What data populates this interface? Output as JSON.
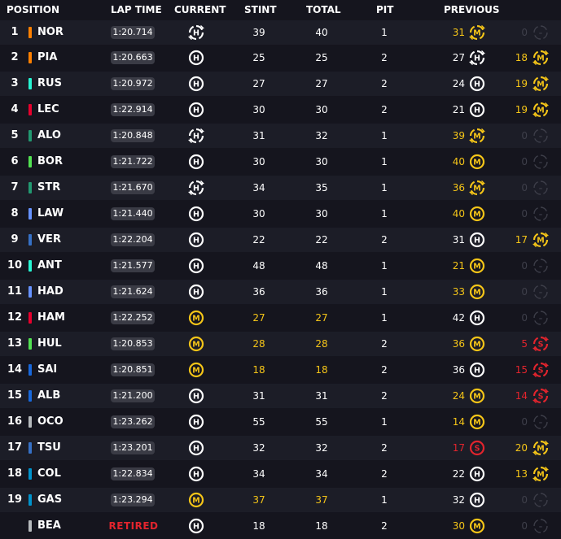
{
  "header": {
    "position": "POSITION",
    "lap_time": "LAP TIME",
    "current": "CURRENT",
    "stint": "STINT",
    "total": "TOTAL",
    "pit": "PIT",
    "previous": "PREVIOUS"
  },
  "tyre_letters": {
    "hard": "H",
    "medium": "M",
    "soft": "S",
    "none": "–"
  },
  "colors": {
    "hard": "#ffffff",
    "medium": "#f5c518",
    "soft": "#e2242d",
    "none": "#3e3f4a",
    "highlight": "#f5c518",
    "retired": "#e2242d",
    "mclaren": "#ff8000",
    "mercedes": "#27f4d2",
    "ferrari": "#e8002d",
    "aston": "#229971",
    "sauber": "#52e252",
    "rb": "#6692ff",
    "redbull": "#3671c6",
    "haas": "#b6babd",
    "williams": "#1868db",
    "alpine": "#0093cc"
  },
  "rows": [
    {
      "pos": "1",
      "abbr": "NOR",
      "team_color": "#ff8000",
      "lap": "1:20.714",
      "cur": "hard",
      "cur_new": false,
      "stint": "39",
      "total": "40",
      "pit": "1",
      "prev_n": "31",
      "prev": "medium",
      "prev_new": false,
      "old_n": "0",
      "old": "none"
    },
    {
      "pos": "2",
      "abbr": "PIA",
      "team_color": "#ff8000",
      "lap": "1:20.663",
      "cur": "hard",
      "cur_new": true,
      "stint": "25",
      "total": "25",
      "pit": "2",
      "prev_n": "27",
      "prev": "hard",
      "prev_new": false,
      "old_n": "18",
      "old": "medium"
    },
    {
      "pos": "3",
      "abbr": "RUS",
      "team_color": "#27f4d2",
      "lap": "1:20.972",
      "cur": "hard",
      "cur_new": true,
      "stint": "27",
      "total": "27",
      "pit": "2",
      "prev_n": "24",
      "prev": "hard",
      "prev_new": true,
      "old_n": "19",
      "old": "medium"
    },
    {
      "pos": "4",
      "abbr": "LEC",
      "team_color": "#e8002d",
      "lap": "1:22.914",
      "cur": "hard",
      "cur_new": true,
      "stint": "30",
      "total": "30",
      "pit": "2",
      "prev_n": "21",
      "prev": "hard",
      "prev_new": true,
      "old_n": "19",
      "old": "medium"
    },
    {
      "pos": "5",
      "abbr": "ALO",
      "team_color": "#229971",
      "lap": "1:20.848",
      "cur": "hard",
      "cur_new": false,
      "stint": "31",
      "total": "32",
      "pit": "1",
      "prev_n": "39",
      "prev": "medium",
      "prev_new": false,
      "old_n": "0",
      "old": "none"
    },
    {
      "pos": "6",
      "abbr": "BOR",
      "team_color": "#52e252",
      "lap": "1:21.722",
      "cur": "hard",
      "cur_new": true,
      "stint": "30",
      "total": "30",
      "pit": "1",
      "prev_n": "40",
      "prev": "medium",
      "prev_new": true,
      "old_n": "0",
      "old": "none"
    },
    {
      "pos": "7",
      "abbr": "STR",
      "team_color": "#229971",
      "lap": "1:21.670",
      "cur": "hard",
      "cur_new": false,
      "stint": "34",
      "total": "35",
      "pit": "1",
      "prev_n": "36",
      "prev": "medium",
      "prev_new": false,
      "old_n": "0",
      "old": "none"
    },
    {
      "pos": "8",
      "abbr": "LAW",
      "team_color": "#6692ff",
      "lap": "1:21.440",
      "cur": "hard",
      "cur_new": true,
      "stint": "30",
      "total": "30",
      "pit": "1",
      "prev_n": "40",
      "prev": "medium",
      "prev_new": true,
      "old_n": "0",
      "old": "none"
    },
    {
      "pos": "9",
      "abbr": "VER",
      "team_color": "#3671c6",
      "lap": "1:22.204",
      "cur": "hard",
      "cur_new": true,
      "stint": "22",
      "total": "22",
      "pit": "2",
      "prev_n": "31",
      "prev": "hard",
      "prev_new": true,
      "old_n": "17",
      "old": "medium"
    },
    {
      "pos": "10",
      "abbr": "ANT",
      "team_color": "#27f4d2",
      "lap": "1:21.577",
      "cur": "hard",
      "cur_new": true,
      "stint": "48",
      "total": "48",
      "pit": "1",
      "prev_n": "21",
      "prev": "medium",
      "prev_new": true,
      "old_n": "0",
      "old": "none"
    },
    {
      "pos": "11",
      "abbr": "HAD",
      "team_color": "#6692ff",
      "lap": "1:21.624",
      "cur": "hard",
      "cur_new": true,
      "stint": "36",
      "total": "36",
      "pit": "1",
      "prev_n": "33",
      "prev": "medium",
      "prev_new": true,
      "old_n": "0",
      "old": "none"
    },
    {
      "pos": "12",
      "abbr": "HAM",
      "team_color": "#e8002d",
      "lap": "1:22.252",
      "cur": "medium",
      "cur_new": true,
      "stint": "27",
      "total": "27",
      "pit": "1",
      "prev_n": "42",
      "prev": "hard",
      "prev_new": true,
      "old_n": "0",
      "old": "none"
    },
    {
      "pos": "13",
      "abbr": "HUL",
      "team_color": "#52e252",
      "lap": "1:20.853",
      "cur": "medium",
      "cur_new": true,
      "stint": "28",
      "total": "28",
      "pit": "2",
      "prev_n": "36",
      "prev": "medium",
      "prev_new": true,
      "old_n": "5",
      "old": "soft"
    },
    {
      "pos": "14",
      "abbr": "SAI",
      "team_color": "#1868db",
      "lap": "1:20.851",
      "cur": "medium",
      "cur_new": true,
      "stint": "18",
      "total": "18",
      "pit": "2",
      "prev_n": "36",
      "prev": "hard",
      "prev_new": true,
      "old_n": "15",
      "old": "soft"
    },
    {
      "pos": "15",
      "abbr": "ALB",
      "team_color": "#1868db",
      "lap": "1:21.200",
      "cur": "hard",
      "cur_new": true,
      "stint": "31",
      "total": "31",
      "pit": "2",
      "prev_n": "24",
      "prev": "medium",
      "prev_new": true,
      "old_n": "14",
      "old": "soft"
    },
    {
      "pos": "16",
      "abbr": "OCO",
      "team_color": "#b6babd",
      "lap": "1:23.262",
      "cur": "hard",
      "cur_new": true,
      "stint": "55",
      "total": "55",
      "pit": "1",
      "prev_n": "14",
      "prev": "medium",
      "prev_new": true,
      "old_n": "0",
      "old": "none"
    },
    {
      "pos": "17",
      "abbr": "TSU",
      "team_color": "#3671c6",
      "lap": "1:23.201",
      "cur": "hard",
      "cur_new": true,
      "stint": "32",
      "total": "32",
      "pit": "2",
      "prev_n": "17",
      "prev": "soft",
      "prev_new": true,
      "old_n": "20",
      "old": "medium"
    },
    {
      "pos": "18",
      "abbr": "COL",
      "team_color": "#0093cc",
      "lap": "1:22.834",
      "cur": "hard",
      "cur_new": true,
      "stint": "34",
      "total": "34",
      "pit": "2",
      "prev_n": "22",
      "prev": "hard",
      "prev_new": true,
      "old_n": "13",
      "old": "medium"
    },
    {
      "pos": "19",
      "abbr": "GAS",
      "team_color": "#0093cc",
      "lap": "1:23.294",
      "cur": "medium",
      "cur_new": true,
      "stint": "37",
      "total": "37",
      "pit": "1",
      "prev_n": "32",
      "prev": "hard",
      "prev_new": true,
      "old_n": "0",
      "old": "none"
    },
    {
      "pos": "",
      "abbr": "BEA",
      "team_color": "#b6babd",
      "lap": "",
      "retired": "RETIRED",
      "cur": "hard",
      "cur_new": true,
      "stint": "18",
      "total": "18",
      "pit": "2",
      "prev_n": "30",
      "prev": "medium",
      "prev_new": true,
      "old_n": "0",
      "old": "none"
    }
  ]
}
